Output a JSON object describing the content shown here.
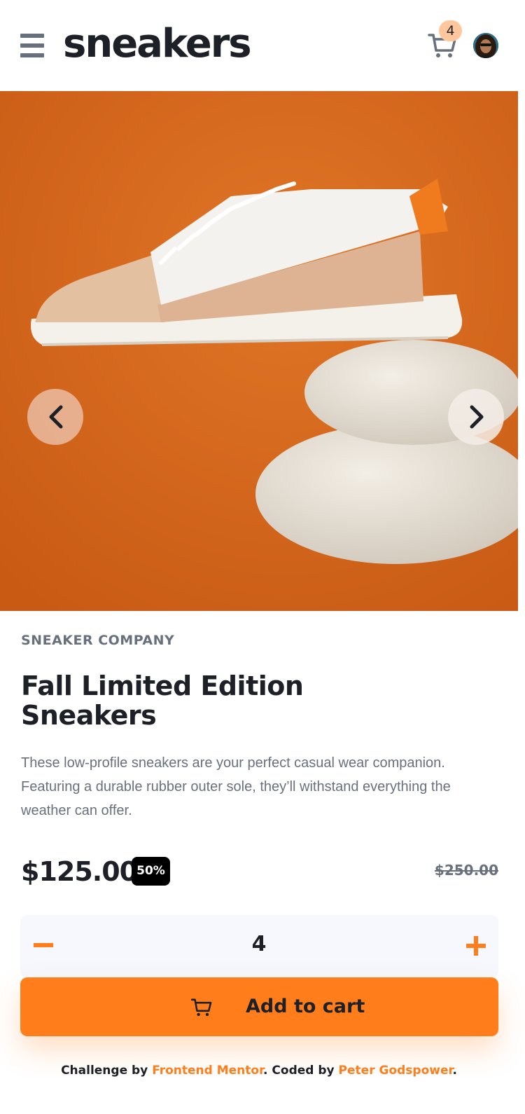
{
  "header": {
    "logo": "sneakers",
    "cart_count": "4",
    "menu_icon": "hamburger-menu-icon",
    "cart_icon": "cart-icon"
  },
  "hero": {
    "prev_icon": "chevron-left-icon",
    "next_icon": "chevron-right-icon"
  },
  "product": {
    "company": "SNEAKER COMPANY",
    "title": "Fall Limited Edition Sneakers",
    "description": "These low-profile sneakers are your perfect casual wear companion. Featuring a durable rubber outer sole, they’ll withstand everything the weather can offer.",
    "price": "$125.00",
    "discount": "50%",
    "original_price": "$250.00"
  },
  "quantity": {
    "value": "4"
  },
  "add_to_cart": {
    "label": "Add to cart"
  },
  "footer": {
    "prefix": "Challenge by ",
    "challenge_link": "Frontend Mentor",
    "middle": ". Coded by ",
    "author_link": "Peter Godspower",
    "suffix": "."
  },
  "colors": {
    "accent": "#ff7e1b",
    "accent_light": "#ffc79b",
    "dark": "#1d2026",
    "gray": "#69707d",
    "light_bg": "#f6f8fd"
  }
}
